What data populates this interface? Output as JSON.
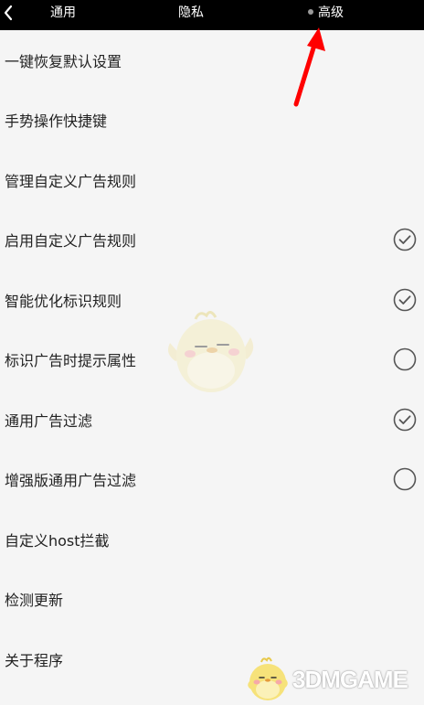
{
  "colors": {
    "topbar_background": "#000000",
    "topbar_text": "#ffffff",
    "page_background": "#f5f5f5",
    "text": "#222222",
    "check_outline": "#555555",
    "annotation_arrow": "#ff0000"
  },
  "topbar": {
    "back_icon": "chevron-left-icon",
    "tabs": [
      {
        "label": "通用",
        "active": false
      },
      {
        "label": "隐私",
        "active": false
      },
      {
        "label": "高级",
        "active": true
      }
    ]
  },
  "menu": [
    {
      "label": "一键恢复默认设置",
      "check": null
    },
    {
      "label": "手势操作快捷键",
      "check": null
    },
    {
      "label": "管理自定义广告规则",
      "check": null
    },
    {
      "label": "启用自定义广告规则",
      "check": true
    },
    {
      "label": "智能优化标识规则",
      "check": true
    },
    {
      "label": "标识广告时提示属性",
      "check": false
    },
    {
      "label": "通用广告过滤",
      "check": true
    },
    {
      "label": "增强版通用广告过滤",
      "check": false
    },
    {
      "label": "自定义host拦截",
      "check": null
    },
    {
      "label": "检测更新",
      "check": null
    },
    {
      "label": "关于程序",
      "check": null
    }
  ],
  "watermark": {
    "logo_text": "3DMGAME",
    "mascot_icon": "chick-mascot-icon"
  }
}
